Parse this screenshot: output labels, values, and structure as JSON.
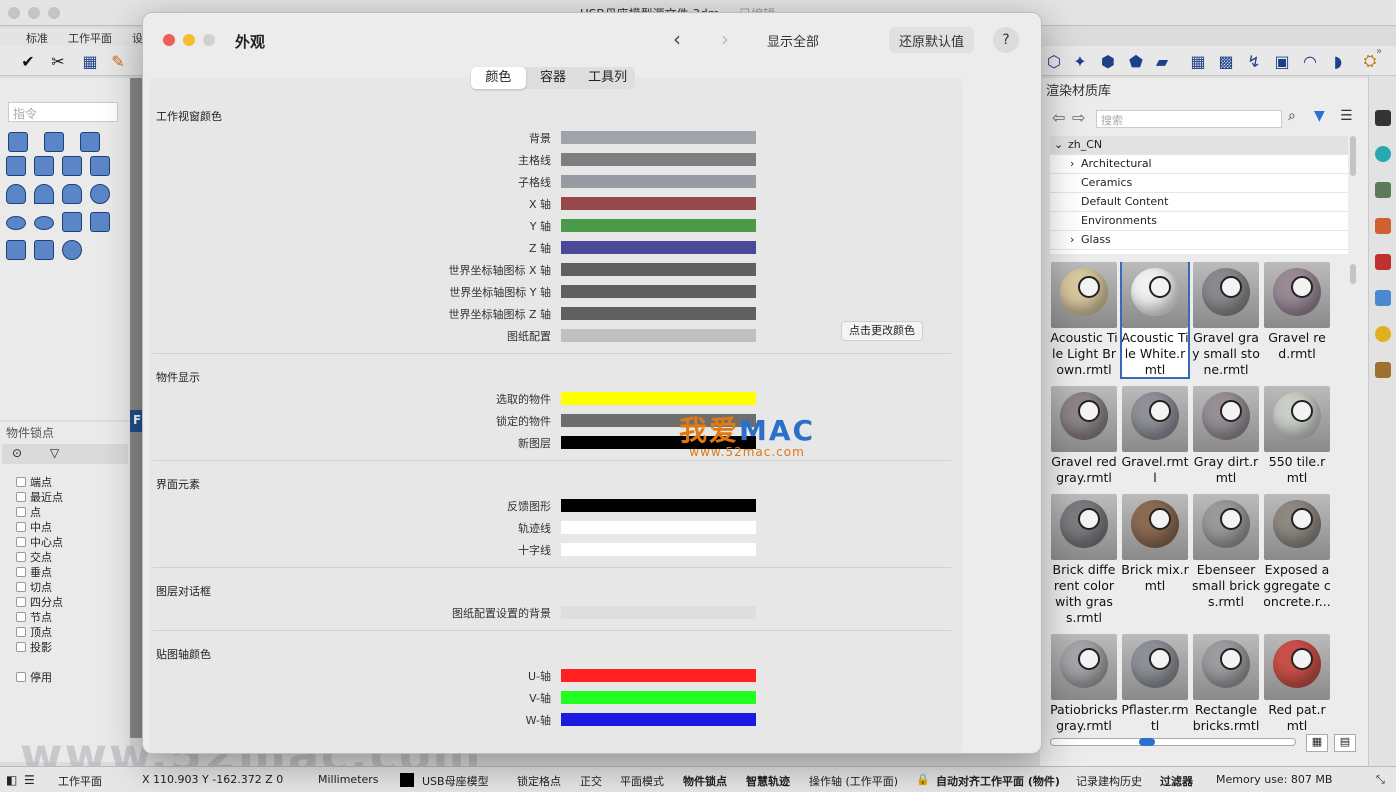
{
  "app": {
    "title": "USB母座模型源文件.3dm",
    "title_suffix": " — 已编辑"
  },
  "toolbar_tabs": [
    "标准",
    "工作平面",
    "设"
  ],
  "command_placeholder": "指令",
  "osnap": {
    "title": "物件锁点",
    "items": [
      "端点",
      "最近点",
      "点",
      "中点",
      "中心点",
      "交点",
      "垂点",
      "切点",
      "四分点",
      "节点",
      "顶点",
      "投影"
    ],
    "disable": "停用"
  },
  "library": {
    "title": "渲染材质库",
    "search_placeholder": "搜索",
    "tree": [
      {
        "label": "zh_CN",
        "expanded": true,
        "depth": 0
      },
      {
        "label": "Architectural",
        "expanded": false,
        "depth": 1
      },
      {
        "label": "Ceramics",
        "depth": 1
      },
      {
        "label": "Default Content",
        "depth": 1
      },
      {
        "label": "Environments",
        "depth": 1
      },
      {
        "label": "Glass",
        "expanded": false,
        "depth": 1
      }
    ],
    "materials": [
      {
        "name": "Acoustic Tile Light Brown.rmtl",
        "color": "#d9c9a0"
      },
      {
        "name": "Acoustic Tile White.rmtl",
        "color": "#f0f0f0",
        "selected": true
      },
      {
        "name": "Gravel gray small stone.rmtl",
        "color": "#8a8a8e"
      },
      {
        "name": "Gravel red.rmtl",
        "color": "#9a8a96"
      },
      {
        "name": "Gravel red gray.rmtl",
        "color": "#8c858a"
      },
      {
        "name": "Gravel.rmtl",
        "color": "#8f9098"
      },
      {
        "name": "Gray dirt.rmtl",
        "color": "#968f96"
      },
      {
        "name": "550 tile.rmtl",
        "color": "#c9cec6"
      },
      {
        "name": "Brick different color with grass.rmtl",
        "color": "#7a7c80"
      },
      {
        "name": "Brick mix.rmtl",
        "color": "#8c6a52"
      },
      {
        "name": "Ebenseer small bricks.rmtl",
        "color": "#9a9a9c"
      },
      {
        "name": "Exposed aggregate concrete.r...",
        "color": "#8e8882"
      },
      {
        "name": "Patiobricks gray.rmtl",
        "color": "#a6a6aa"
      },
      {
        "name": "Pflaster.rmtl",
        "color": "#8e9098"
      },
      {
        "name": "Rectangle bricks.rmtl",
        "color": "#9c9ca0"
      },
      {
        "name": "Red pat.rmtl",
        "color": "#c85048"
      }
    ]
  },
  "modal": {
    "title": "外观",
    "show_all": "显示全部",
    "restore": "还原默认值",
    "help": "?",
    "tabs": [
      {
        "label": "颜色",
        "active": true
      },
      {
        "label": "容器"
      },
      {
        "label": "工具列"
      }
    ],
    "change_color": "点击更改颜色",
    "sections": [
      {
        "title": "工作视窗颜色",
        "rows": [
          {
            "label": "背景",
            "color": "#a0a4aa"
          },
          {
            "label": "主格线",
            "color": "#7c7e82"
          },
          {
            "label": "子格线",
            "color": "#989ca2"
          },
          {
            "label": "X 轴",
            "color": "#974848"
          },
          {
            "label": "Y 轴",
            "color": "#4a9a4a"
          },
          {
            "label": "Z 轴",
            "color": "#4a4a98"
          },
          {
            "label": "世界坐标轴图标 X 轴",
            "color": "#606060"
          },
          {
            "label": "世界坐标轴图标 Y 轴",
            "color": "#606060"
          },
          {
            "label": "世界坐标轴图标 Z 轴",
            "color": "#606060"
          },
          {
            "label": "图纸配置",
            "color": "#c0c0c0"
          }
        ]
      },
      {
        "title": "物件显示",
        "rows": [
          {
            "label": "选取的物件",
            "color": "#ffff00"
          },
          {
            "label": "锁定的物件",
            "color": "#6e6e6e"
          },
          {
            "label": "新图层",
            "color": "#000000"
          }
        ]
      },
      {
        "title": "界面元素",
        "rows": [
          {
            "label": "反馈图形",
            "color": "#000000"
          },
          {
            "label": "轨迹线",
            "color": "#ffffff"
          },
          {
            "label": "十字线",
            "color": "#ffffff"
          }
        ]
      },
      {
        "title": "图层对话框",
        "rows": [
          {
            "label": "图纸配置设置的背景",
            "color": "#dedede"
          }
        ]
      },
      {
        "title": "贴图轴颜色",
        "rows": [
          {
            "label": "U-轴",
            "color": "#ff2020"
          },
          {
            "label": "V-轴",
            "color": "#20ff20"
          },
          {
            "label": "W-轴",
            "color": "#1a1ae0"
          }
        ]
      }
    ]
  },
  "watermark": {
    "logo_a": "我爱",
    "logo_b": "MAC",
    "url": "www.52mac.com",
    "bottom": "www.52mac.com"
  },
  "status": {
    "cplane": "工作平面",
    "coords": "X 110.903 Y -162.372 Z 0",
    "units": "Millimeters",
    "layer": "USB母座模型",
    "items": [
      {
        "label": "锁定格点",
        "bold": false
      },
      {
        "label": "正交",
        "bold": false
      },
      {
        "label": "平面模式",
        "bold": false
      },
      {
        "label": "物件锁点",
        "bold": true
      },
      {
        "label": "智慧轨迹",
        "bold": true
      },
      {
        "label": "操作轴 (工作平面)",
        "bold": false
      },
      {
        "label": "自动对齐工作平面 (物件)",
        "bold": true
      },
      {
        "label": "记录建构历史",
        "bold": false
      },
      {
        "label": "过滤器",
        "bold": true
      }
    ],
    "memory": "Memory use: 807 MB"
  }
}
